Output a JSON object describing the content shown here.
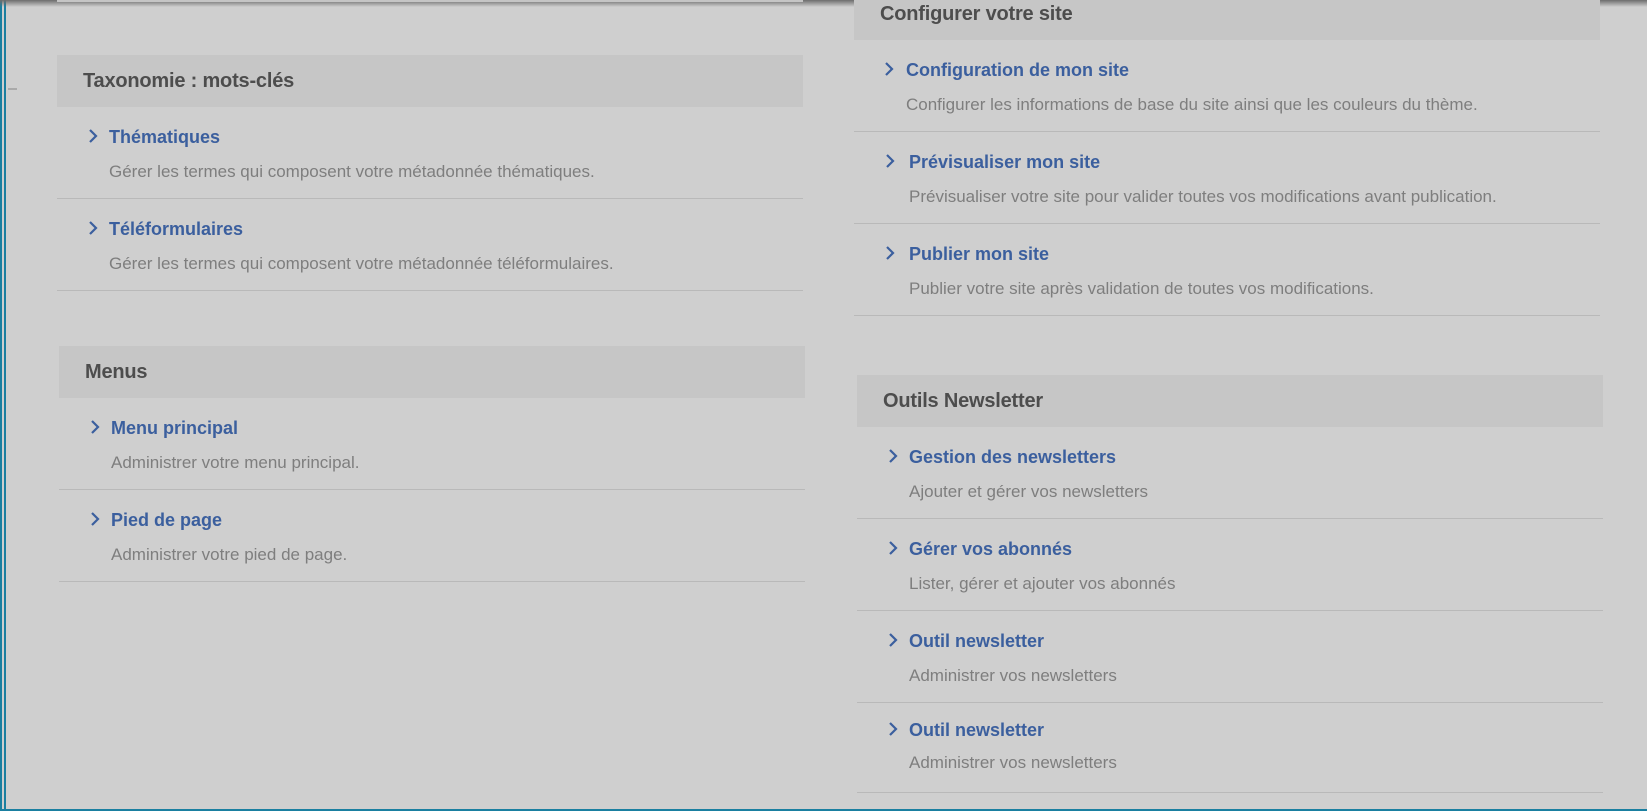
{
  "colors": {
    "overlay_background": "#cfcfcf",
    "panel_header": "#c6c6c6",
    "link": "#3b5f9e",
    "description": "#7e7e7e",
    "frame_accent": "#1a7fa0"
  },
  "panels": {
    "taxonomy": {
      "title": "Taxonomie : mots-clés",
      "items": [
        {
          "title": "Thématiques",
          "description": "Gérer les termes qui composent votre métadonnée thématiques."
        },
        {
          "title": "Téléformulaires",
          "description": "Gérer les termes qui composent votre métadonnée téléformulaires."
        }
      ]
    },
    "menus": {
      "title": "Menus",
      "items": [
        {
          "title": "Menu principal",
          "description": "Administrer votre menu principal."
        },
        {
          "title": "Pied de page",
          "description": "Administrer votre pied de page."
        }
      ]
    },
    "configure": {
      "title": "Configurer votre site",
      "items": [
        {
          "title": "Configuration de mon site",
          "description": "Configurer les informations de base du site ainsi que les couleurs du thème."
        },
        {
          "title": "Prévisualiser mon site",
          "description": "Prévisualiser votre site pour valider toutes vos modifications avant publication."
        },
        {
          "title": "Publier mon site",
          "description": "Publier votre site après validation de toutes vos modifications."
        }
      ]
    },
    "newsletter": {
      "title": "Outils Newsletter",
      "items": [
        {
          "title": "Gestion des newsletters",
          "description": "Ajouter et gérer vos newsletters"
        },
        {
          "title": "Gérer vos abonnés",
          "description": "Lister, gérer et ajouter vos abonnés"
        },
        {
          "title": "Outil newsletter",
          "description": "Administrer vos newsletters"
        },
        {
          "title": "Outil newsletter",
          "description": "Administrer vos newsletters"
        }
      ]
    }
  },
  "icons": {
    "item_chevron": "chevron-right-icon"
  }
}
